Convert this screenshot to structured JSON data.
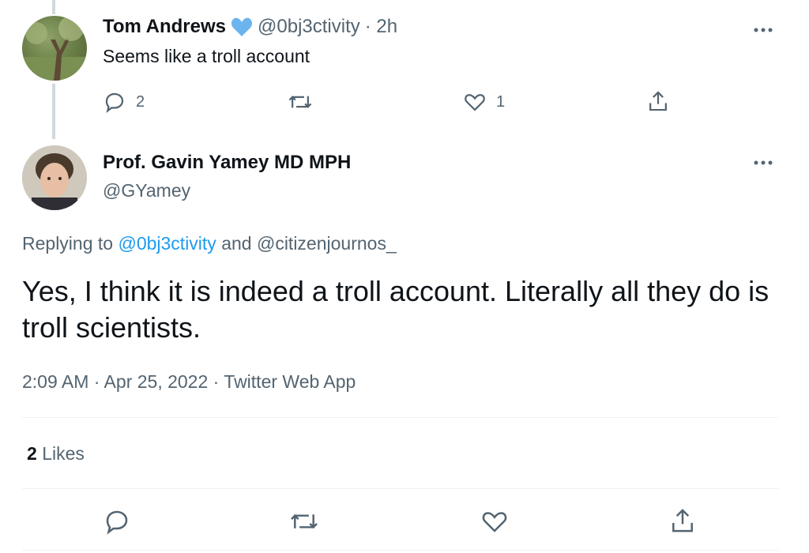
{
  "reply": {
    "author_name": "Tom Andrews",
    "handle": "@0bj3ctivity",
    "time": "· 2h",
    "text": "Seems like a troll account",
    "reply_count": "2",
    "like_count": "1"
  },
  "main": {
    "author_name": "Prof. Gavin Yamey MD MPH",
    "handle": "@GYamey",
    "replying_prefix": "Replying to",
    "replying_user1": "@0bj3ctivity",
    "replying_and": "and",
    "replying_user2": "@citizenjournos_",
    "text": "Yes, I think it is indeed a troll account. Literally all they do is troll scientists.",
    "meta": "2:09 AM · Apr 25, 2022 · Twitter Web App",
    "likes_count": "2",
    "likes_label": "Likes"
  },
  "icons": {
    "more": "more-horizontal-icon",
    "verified": "verified-heart-icon",
    "reply": "reply-icon",
    "retweet": "retweet-icon",
    "like": "like-icon",
    "share": "share-icon"
  },
  "colors": {
    "accent": "#1d9bf0",
    "text": "#0f1419",
    "muted": "#536471",
    "line": "#cfd9de"
  }
}
